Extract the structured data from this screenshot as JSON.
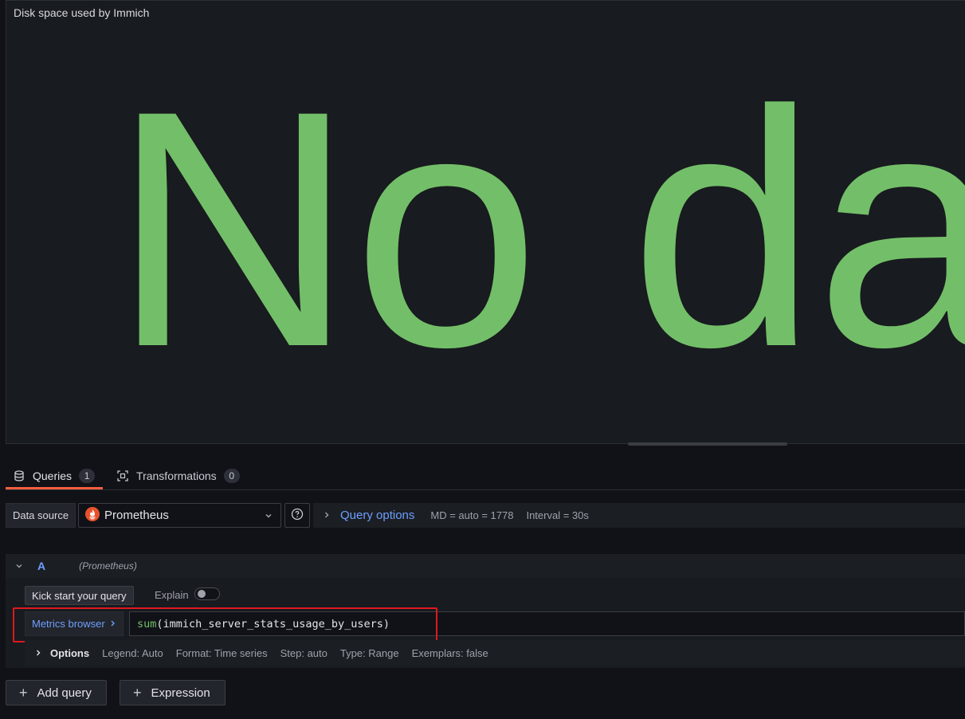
{
  "panel": {
    "title": "Disk space used by Immich",
    "no_data_text": "No da",
    "no_data_color": "#73bf69"
  },
  "tabs": [
    {
      "label": "Queries",
      "count": "1",
      "icon": "database-icon",
      "active": true
    },
    {
      "label": "Transformations",
      "count": "0",
      "icon": "transform-icon",
      "active": false
    }
  ],
  "datasource": {
    "label": "Data source",
    "selected": "Prometheus",
    "icon": "prometheus-logo"
  },
  "query_options": {
    "title": "Query options",
    "md": "MD = auto = 1778",
    "interval": "Interval = 30s"
  },
  "query": {
    "ref_id": "A",
    "datasource": "(Prometheus)",
    "kick_start": "Kick start your query",
    "explain": "Explain",
    "explain_enabled": false,
    "metrics_browser": "Metrics browser",
    "expr_fn": "sum",
    "expr_rest": "(immich_server_stats_usage_by_users)",
    "options": {
      "title": "Options",
      "legend": "Legend: Auto",
      "format": "Format: Time series",
      "step": "Step: auto",
      "type": "Type: Range",
      "exemplars": "Exemplars: false"
    }
  },
  "buttons": {
    "add_query": "Add query",
    "expression": "Expression"
  },
  "colors": {
    "accent": "#6e9fff",
    "active_tab": "#f55f3e",
    "highlight_box": "#e0181f"
  }
}
